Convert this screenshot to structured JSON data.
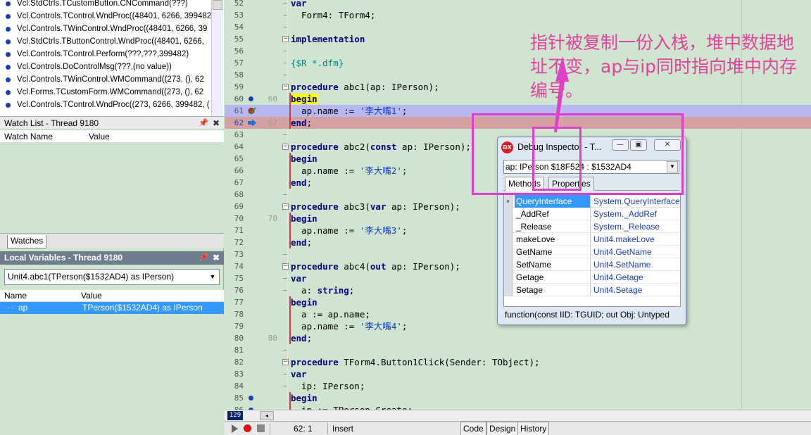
{
  "call_stack": [
    "Vcl.StdCtrls.TCustomButton.CNCommand(???)",
    "Vcl.Controls.TControl.WndProc((48401, 6266, 399482",
    "Vcl.Controls.TWinControl.WndProc((48401, 6266, 39",
    "Vcl.StdCtrls.TButtonControl.WndProc((48401, 6266,",
    "Vcl.Controls.TControl.Perform(???,???,399482)",
    "Vcl.Controls.DoControlMsg(???,(no value))",
    "Vcl.Controls.TWinControl.WMCommand((273, (), 62",
    "Vcl.Forms.TCustomForm.WMCommand((273, (), 62",
    "Vcl.Controls.TControl.WndProc((273, 6266, 399482, ("
  ],
  "watch": {
    "title": "Watch List - Thread 9180",
    "col_name": "Watch Name",
    "col_value": "Value",
    "tab": "Watches",
    "pin": "📌",
    "close": "✖"
  },
  "locals": {
    "title": "Local Variables - Thread 9180",
    "selector": "Unit4.abc1(TPerson($1532AD4) as IPerson)",
    "col_name": "Name",
    "col_value": "Value",
    "row_name": "ap",
    "row_value": "TPerson($1532AD4) as IPerson"
  },
  "editor": {
    "lines": [
      {
        "n": "52",
        "mk": "",
        "fold": "",
        "bp": false,
        "code_html": "<span class=\"kw\">var</span>"
      },
      {
        "n": "53",
        "mk": "",
        "fold": "",
        "bp": false,
        "code": "  Form4: TForm4;"
      },
      {
        "n": "54",
        "mk": "",
        "fold": "",
        "bp": false,
        "code": ""
      },
      {
        "n": "55",
        "mk": "",
        "fold": "minus",
        "bp": false,
        "code_html": "<span class=\"kw\">implementation</span>"
      },
      {
        "n": "56",
        "mk": "",
        "fold": "",
        "bp": false,
        "code": ""
      },
      {
        "n": "57",
        "mk": "",
        "fold": "",
        "bp": false,
        "code_html": "<span class=\"cmt\">{$R *.dfm}</span>"
      },
      {
        "n": "58",
        "mk": "",
        "fold": "",
        "bp": false,
        "code": ""
      },
      {
        "n": "59",
        "mk": "",
        "fold": "box",
        "bp": false,
        "code_html": "<span class=\"kw\">procedure</span> abc1(ap: IPerson);"
      },
      {
        "n": "60",
        "mk": "60",
        "fold": "",
        "bp": true,
        "red": true,
        "code_html": "<span class=\"kw begin\">begin</span>"
      },
      {
        "n": "61",
        "mk": "",
        "fold": "",
        "bp": false,
        "red": true,
        "special": "bpcheck",
        "code_html": "  ap.name := <span class=\"str\">'李大嘴1'</span>;"
      },
      {
        "n": "62",
        "mk": "62",
        "fold": "",
        "bp": false,
        "red": true,
        "special": "arrow",
        "code_html": "<span class=\"kw\">end</span>;"
      },
      {
        "n": "63",
        "mk": "",
        "fold": "",
        "bp": false,
        "code": ""
      },
      {
        "n": "64",
        "mk": "",
        "fold": "box",
        "bp": false,
        "code_html": "<span class=\"kw\">procedure</span> abc2(<span class=\"kw\">const</span> ap: IPerson);"
      },
      {
        "n": "65",
        "mk": "",
        "fold": "",
        "bp": false,
        "red": true,
        "code_html": "<span class=\"kw\">begin</span>"
      },
      {
        "n": "66",
        "mk": "",
        "fold": "",
        "bp": false,
        "red": true,
        "code_html": "  ap.name := <span class=\"str\">'李大嘴2'</span>;"
      },
      {
        "n": "67",
        "mk": "",
        "fold": "",
        "bp": false,
        "red": true,
        "code_html": "<span class=\"kw\">end</span>;"
      },
      {
        "n": "68",
        "mk": "",
        "fold": "",
        "bp": false,
        "code": ""
      },
      {
        "n": "69",
        "mk": "",
        "fold": "box",
        "bp": false,
        "code_html": "<span class=\"kw\">procedure</span> abc3(<span class=\"kw\">var</span> ap: IPerson);"
      },
      {
        "n": "70",
        "mk": "70",
        "fold": "",
        "bp": false,
        "red": true,
        "code_html": "<span class=\"kw\">begin</span>"
      },
      {
        "n": "71",
        "mk": "",
        "fold": "",
        "bp": false,
        "red": true,
        "code_html": "  ap.name := <span class=\"str\">'李大嘴3'</span>;"
      },
      {
        "n": "72",
        "mk": "",
        "fold": "",
        "bp": false,
        "red": true,
        "code_html": "<span class=\"kw\">end</span>;"
      },
      {
        "n": "73",
        "mk": "",
        "fold": "",
        "bp": false,
        "code": ""
      },
      {
        "n": "74",
        "mk": "",
        "fold": "box",
        "bp": false,
        "code_html": "<span class=\"kw\">procedure</span> abc4(<span class=\"kw\">out</span> ap: IPerson);"
      },
      {
        "n": "75",
        "mk": "",
        "fold": "",
        "bp": false,
        "code_html": "<span class=\"kw\">var</span>"
      },
      {
        "n": "76",
        "mk": "",
        "fold": "",
        "bp": false,
        "code_html": "  a: <span class=\"kw\">string</span>;"
      },
      {
        "n": "77",
        "mk": "",
        "fold": "",
        "bp": false,
        "red": true,
        "code_html": "<span class=\"kw\">begin</span>"
      },
      {
        "n": "78",
        "mk": "",
        "fold": "",
        "bp": false,
        "red": true,
        "code": "  a := ap.name;"
      },
      {
        "n": "79",
        "mk": "",
        "fold": "",
        "bp": false,
        "red": true,
        "code_html": "  ap.name := <span class=\"str\">'李大嘴4'</span>;"
      },
      {
        "n": "80",
        "mk": "80",
        "fold": "",
        "bp": false,
        "red": true,
        "code_html": "<span class=\"kw\">end</span>;"
      },
      {
        "n": "81",
        "mk": "",
        "fold": "",
        "bp": false,
        "code": ""
      },
      {
        "n": "82",
        "mk": "",
        "fold": "box",
        "bp": false,
        "code_html": "<span class=\"kw\">procedure</span> TForm4.Button1Click(Sender: TObject);"
      },
      {
        "n": "83",
        "mk": "",
        "fold": "",
        "bp": false,
        "code_html": "<span class=\"kw\">var</span>"
      },
      {
        "n": "84",
        "mk": "",
        "fold": "",
        "bp": false,
        "code": "  ip: IPerson;"
      },
      {
        "n": "85",
        "mk": "",
        "fold": "",
        "bp": true,
        "red": true,
        "code_html": "<span class=\"kw\">begin</span>"
      },
      {
        "n": "86",
        "mk": "",
        "fold": "",
        "bp": true,
        "red": true,
        "code": "  ip := TPerson.Create;"
      }
    ]
  },
  "annotation": {
    "text": "指针被复制一份入栈，堆中数据地址不变，ap与ip同时指向堆中内存编号。"
  },
  "inspector": {
    "title": "Debug Inspector - T...",
    "logo": "DX",
    "btn_min": "—",
    "btn_max": "▣",
    "btn_close": "✕",
    "combo": "ap: IPerson $18F524 : $1532AD4",
    "tab_methods": "Methods",
    "tab_properties": "Properties",
    "rows": [
      {
        "name": "QueryInterface",
        "value": "System.QueryInterface"
      },
      {
        "name": "_AddRef",
        "value": "System._AddRef"
      },
      {
        "name": "_Release",
        "value": "System._Release"
      },
      {
        "name": "makeLove",
        "value": "Unit4.makeLove"
      },
      {
        "name": "GetName",
        "value": "Unit4.GetName"
      },
      {
        "name": "SetName",
        "value": "Unit4.SetName"
      },
      {
        "name": "Getage",
        "value": "Unit4.Getage"
      },
      {
        "name": "Setage",
        "value": "Unit4.Setage"
      }
    ],
    "status": "function(const IID: TGUID; out Obj: Untyped"
  },
  "statusbar": {
    "col_indicator": "129",
    "position": "62:  1",
    "mode": "Insert",
    "tab_code": "Code",
    "tab_design": "Design",
    "tab_history": "History",
    "scroll_left": "◂"
  },
  "colors": {
    "editor_bg": "#cfe5cf",
    "current_line": "#b8b8f0",
    "exec_line": "#d4a0a0",
    "annotation": "#e040c8",
    "keyword": "#000080",
    "string": "#1a3fb5"
  }
}
